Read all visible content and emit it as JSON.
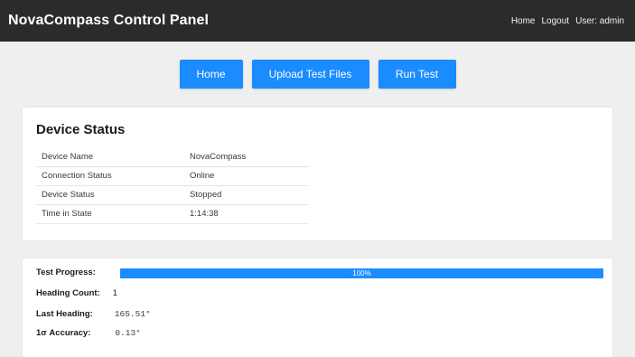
{
  "header": {
    "title": "NovaCompass Control Panel",
    "nav": [
      "Home",
      "Logout",
      "User: admin"
    ]
  },
  "actions": {
    "home_label": "Home",
    "upload_label": "Upload Test Files",
    "run_label": "Run Test"
  },
  "device_status": {
    "title": "Device Status",
    "rows": [
      {
        "key": "Device Name",
        "value": "NovaCompass"
      },
      {
        "key": "Connection Status",
        "value": "Online"
      },
      {
        "key": "Device Status",
        "value": "Stopped"
      },
      {
        "key": "Time in State",
        "value": "1:14:38"
      }
    ]
  },
  "test": {
    "progress_label": "Test Progress:",
    "progress_percent": 100,
    "progress_text": "100%",
    "heading_count_label": "Heading Count:",
    "heading_count": "1",
    "last_heading_label": "Last Heading:",
    "last_heading": "165.51°",
    "accuracy_label": "1σ Accuracy:",
    "accuracy": "0.13°"
  },
  "colors": {
    "topbar": "#2b2b2b",
    "accent": "#1a8cff",
    "background": "#efefef",
    "card": "#ffffff"
  }
}
